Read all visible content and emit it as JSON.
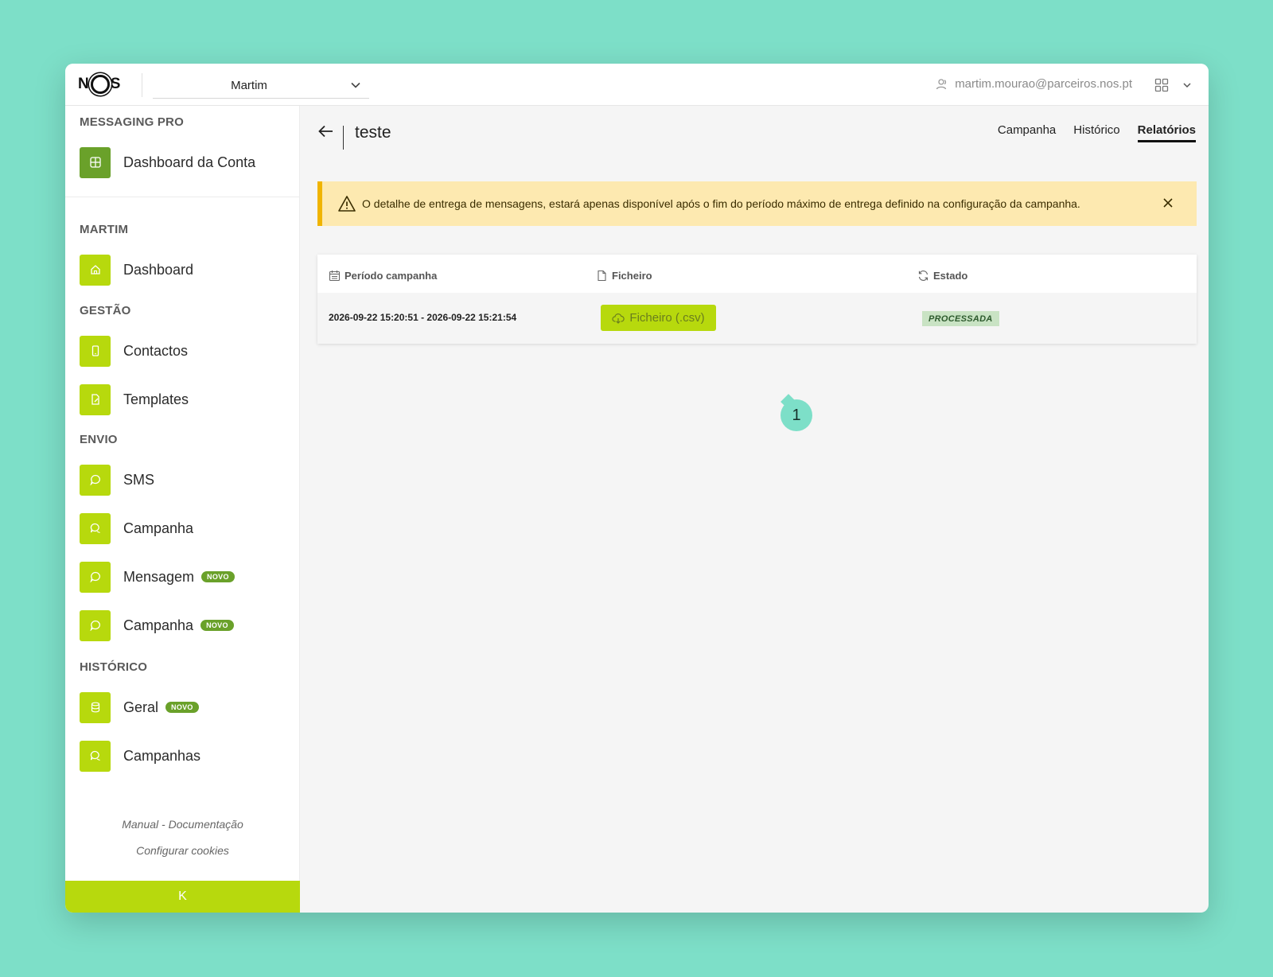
{
  "topbar": {
    "logo_text_left": "N",
    "logo_text_right": "S",
    "account_select_value": "Martim",
    "user_email": "martim.mourao@parceiros.nos.pt"
  },
  "sidebar": {
    "app_section": "MESSAGING PRO",
    "dashboard_account": "Dashboard da Conta",
    "account_section": "MARTIM",
    "dashboard": "Dashboard",
    "gestao_section": "GESTÃO",
    "contactos": "Contactos",
    "templates": "Templates",
    "envio_section": "ENVIO",
    "sms": "SMS",
    "campanha": "Campanha",
    "mensagem": "Mensagem",
    "campanha_novo": "Campanha",
    "historico_section": "HISTÓRICO",
    "geral": "Geral",
    "campanhas": "Campanhas",
    "badge_new": "NOVO",
    "manual_link": "Manual - Documentação",
    "cookies_link": "Configurar cookies",
    "collapse_glyph": "K"
  },
  "main": {
    "title": "teste",
    "tabs": [
      "Campanha",
      "Histórico",
      "Relatórios"
    ],
    "active_tab": "Relatórios",
    "alert_text": "O detalhe de entrega de mensagens, estará apenas disponível após o fim do período máximo de entrega definido na configuração da campanha."
  },
  "table": {
    "headers": {
      "period": "Período campanha",
      "file": "Ficheiro",
      "status": "Estado"
    },
    "rows": [
      {
        "period": "2026-09-22 15:20:51 - 2026-09-22 15:21:54",
        "file_button": "Ficheiro (.csv)",
        "status": "PROCESSADA"
      }
    ]
  },
  "annotation": {
    "marker": "1"
  },
  "colors": {
    "accent": "#b7d90d",
    "accent_dark": "#6aa12a",
    "backdrop": "#7ddfc8",
    "alert_bg": "#fde9b0",
    "alert_border": "#f0b400"
  }
}
